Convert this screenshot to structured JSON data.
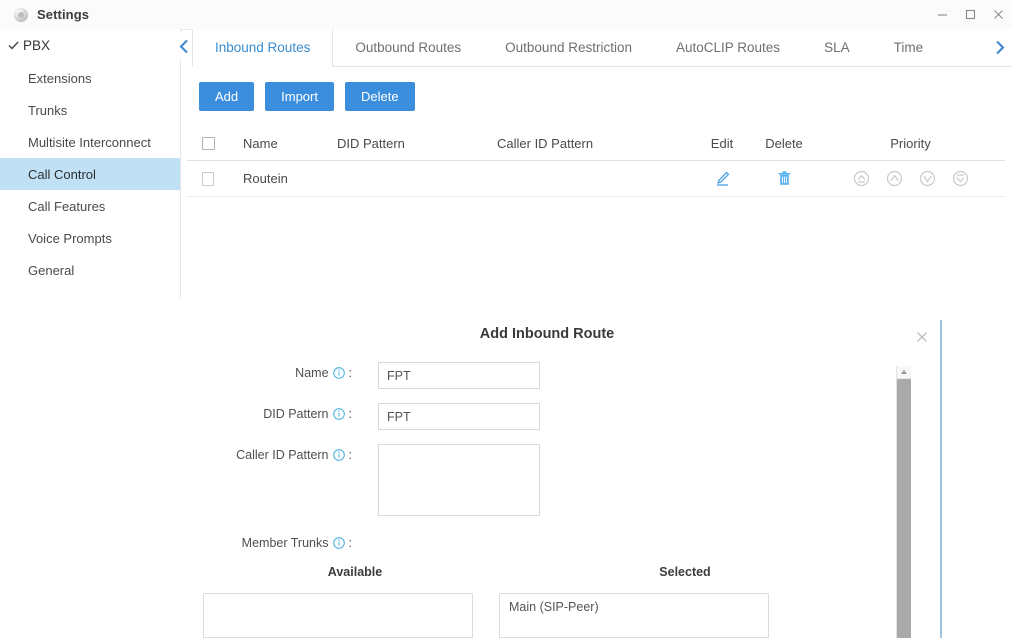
{
  "window": {
    "title": "Settings",
    "icon": "gear-icon",
    "controls": {
      "minimize": "minimize-icon",
      "maximize": "maximize-icon",
      "close": "close-icon"
    }
  },
  "sidebar": {
    "root": {
      "label": "PBX",
      "check": "✓"
    },
    "items": [
      {
        "label": "Extensions",
        "active": false
      },
      {
        "label": "Trunks",
        "active": false
      },
      {
        "label": "Multisite Interconnect",
        "active": false
      },
      {
        "label": "Call Control",
        "active": true
      },
      {
        "label": "Call Features",
        "active": false
      },
      {
        "label": "Voice Prompts",
        "active": false
      },
      {
        "label": "General",
        "active": false
      }
    ],
    "collapse_icon": "chevron-left-icon"
  },
  "tabs": {
    "items": [
      {
        "label": "Inbound Routes",
        "active": true
      },
      {
        "label": "Outbound Routes",
        "active": false
      },
      {
        "label": "Outbound Restriction",
        "active": false
      },
      {
        "label": "AutoCLIP Routes",
        "active": false
      },
      {
        "label": "SLA",
        "active": false
      },
      {
        "label": "Time",
        "active": false
      }
    ],
    "next_icon": "chevron-right-icon"
  },
  "toolbar": {
    "add_label": "Add",
    "import_label": "Import",
    "delete_label": "Delete"
  },
  "table": {
    "columns": [
      "",
      "Name",
      "DID Pattern",
      "Caller ID Pattern",
      "Edit",
      "Delete",
      "Priority"
    ],
    "rows": [
      {
        "name": "Routein",
        "did_pattern": "",
        "caller_id_pattern": "",
        "edit_icon": "pencil-icon",
        "delete_icon": "trash-icon",
        "priority_icons": [
          "move-to-top-icon",
          "move-up-icon",
          "move-down-icon",
          "move-to-bottom-icon"
        ]
      }
    ]
  },
  "dialog": {
    "title": "Add Inbound Route",
    "close_icon": "close-icon",
    "fields": [
      {
        "label": "Name",
        "colon": ":",
        "value": "FPT",
        "placeholder": "",
        "info": "info-icon"
      },
      {
        "label": "DID Pattern",
        "colon": ":",
        "value": "FPT",
        "placeholder": "",
        "info": "info-icon"
      },
      {
        "label": "Caller ID Pattern",
        "colon": ":",
        "value": "",
        "placeholder": "",
        "info": "info-icon"
      }
    ],
    "member_trunks": {
      "label": "Member Trunks",
      "colon": ":",
      "info": "info-icon",
      "available_header": "Available",
      "selected_header": "Selected",
      "available": [],
      "selected": [
        "Main (SIP-Peer)"
      ]
    }
  },
  "colors": {
    "accent_blue": "#3b8ede",
    "tab_active": "#3a8dd0",
    "sidebar_active_bg": "#bfe0f5",
    "info_icon": "#4fb3e0",
    "icon_grey": "#c9c9c9"
  }
}
